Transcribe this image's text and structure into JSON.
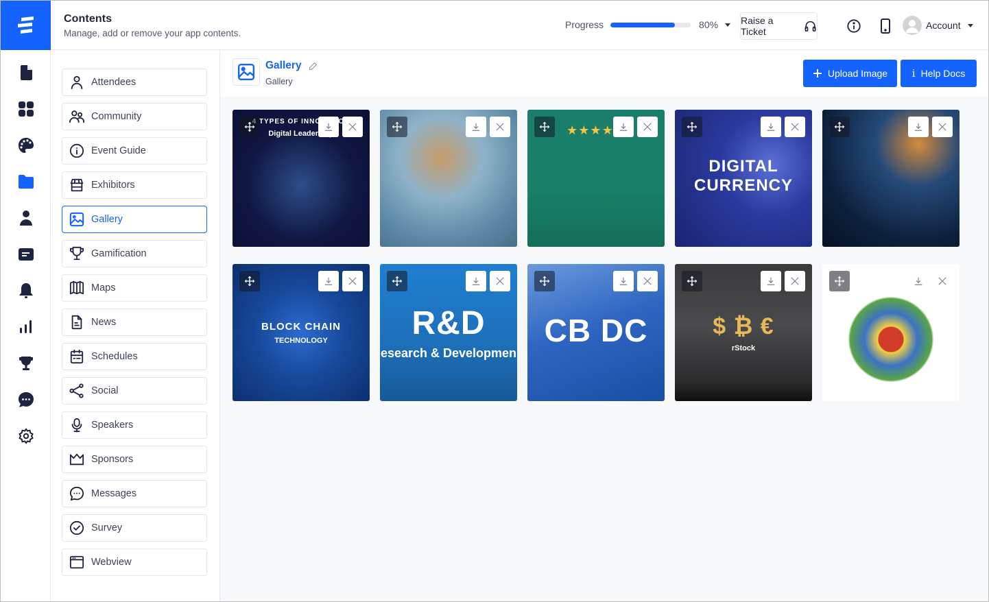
{
  "header": {
    "title": "Contents",
    "subtitle": "Manage, add or remove your app contents.",
    "progress_label": "Progress",
    "progress_percent": 80,
    "progress_text": "80%",
    "raise_ticket_label": "Raise a Ticket",
    "account_label": "Account"
  },
  "colors": {
    "accent": "#1463ff",
    "icon_dark": "#1e2340"
  },
  "rail": {
    "items": [
      {
        "icon": "document-icon"
      },
      {
        "icon": "grid-icon"
      },
      {
        "icon": "palette-icon"
      },
      {
        "icon": "folder-icon",
        "active": true
      },
      {
        "icon": "person-icon"
      },
      {
        "icon": "card-icon"
      },
      {
        "icon": "bell-icon"
      },
      {
        "icon": "bar-chart-icon"
      },
      {
        "icon": "trophy-icon"
      },
      {
        "icon": "chat-icon"
      },
      {
        "icon": "gear-icon"
      }
    ]
  },
  "content_list": {
    "items": [
      {
        "label": "Attendees",
        "icon": "person-outline-icon"
      },
      {
        "label": "Community",
        "icon": "people-icon"
      },
      {
        "label": "Event Guide",
        "icon": "info-circle-icon"
      },
      {
        "label": "Exhibitors",
        "icon": "store-icon"
      },
      {
        "label": "Gallery",
        "icon": "image-icon",
        "active": true
      },
      {
        "label": "Gamification",
        "icon": "trophy-outline-icon"
      },
      {
        "label": "Maps",
        "icon": "map-icon"
      },
      {
        "label": "News",
        "icon": "news-icon"
      },
      {
        "label": "Schedules",
        "icon": "calendar-icon"
      },
      {
        "label": "Social",
        "icon": "share-icon"
      },
      {
        "label": "Speakers",
        "icon": "microphone-icon"
      },
      {
        "label": "Sponsors",
        "icon": "crown-icon"
      },
      {
        "label": "Messages",
        "icon": "message-icon"
      },
      {
        "label": "Survey",
        "icon": "check-circle-icon"
      },
      {
        "label": "Webview",
        "icon": "browser-icon"
      }
    ]
  },
  "main": {
    "title": "Gallery",
    "subtitle": "Gallery",
    "upload_label": "Upload Image",
    "help_label": "Help Docs",
    "images": [
      {
        "caption": "4 TYPES OF INNOVATION",
        "sub": "Digital Leadership"
      },
      {
        "caption": "",
        "sub": ""
      },
      {
        "caption": "★★★★★",
        "sub": ""
      },
      {
        "caption": "DIGITAL CURRENCY",
        "sub": ""
      },
      {
        "caption": "",
        "sub": ""
      },
      {
        "caption": "BLOCK CHAIN",
        "sub": "TECHNOLOGY"
      },
      {
        "caption": "R&D",
        "sub": "esearch & Developmen"
      },
      {
        "caption": "CB DC",
        "sub": ""
      },
      {
        "caption": "$  ₿  €",
        "sub": "rStock"
      },
      {
        "caption": "",
        "sub": ""
      }
    ]
  }
}
